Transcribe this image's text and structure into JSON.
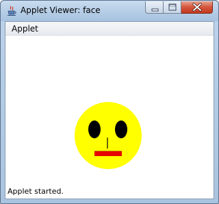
{
  "window": {
    "title": "Applet Viewer: face"
  },
  "menubar": {
    "items": [
      {
        "label": "Applet"
      }
    ]
  },
  "applet": {
    "face_color": "#ffff00",
    "eye_color": "#000000",
    "nose_color": "#000000",
    "mouth_color": "#e60000"
  },
  "status": {
    "text": "Applet started."
  },
  "icons": {
    "app": "java-cup-icon",
    "minimize": "minimize-icon",
    "maximize": "maximize-icon",
    "close": "close-icon"
  }
}
